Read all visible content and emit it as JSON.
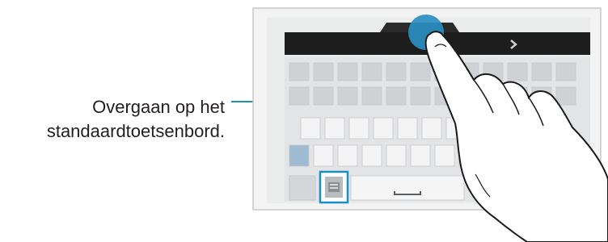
{
  "callout": {
    "line1": "Overgaan op het",
    "line2": "standaardtoetsenbord."
  },
  "icons": {
    "arrow": "chevron-right-icon",
    "mode_switch": "keyboard-switch-icon",
    "space": "space-bar-icon",
    "touch": "finger-touch-indicator"
  },
  "colors": {
    "highlight": "#1a8fc4",
    "touch": "#2a8ec0",
    "key": "#dcdde0",
    "text_bar": "#1d1d1d"
  }
}
